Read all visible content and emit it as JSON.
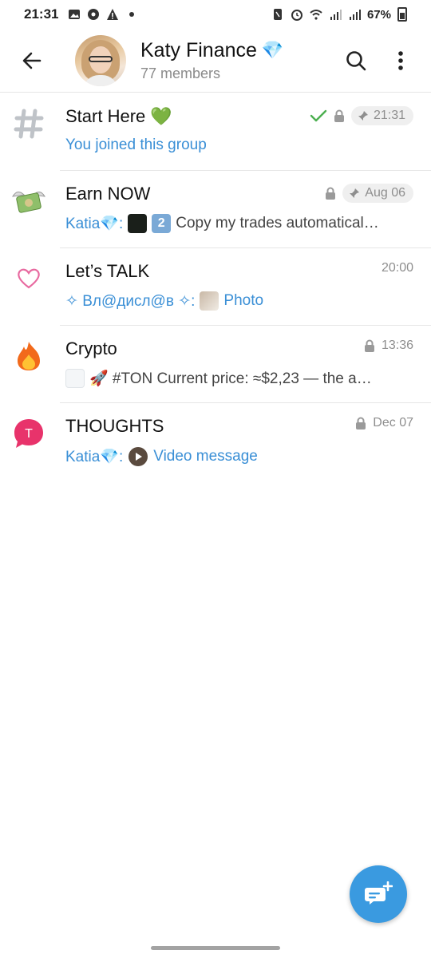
{
  "status_bar": {
    "time": "21:31",
    "battery": "67%",
    "left_icons": [
      "image-icon",
      "soccer-ball-icon",
      "warning-icon",
      "dot-icon"
    ],
    "right_icons": [
      "nfc-icon",
      "alarm-icon",
      "wifi-icon",
      "signal-icon",
      "signal-icon",
      "battery-icon"
    ]
  },
  "header": {
    "title": "Katy Finance",
    "title_emoji": "💎",
    "subtitle": "77 members"
  },
  "topics": [
    {
      "name": "Start Here",
      "name_emoji": "💚",
      "icon": "hash-icon",
      "time": "21:31",
      "read": true,
      "locked": true,
      "pinned": true,
      "message": "You joined this group"
    },
    {
      "name": "Earn NOW",
      "icon": "money-wings-icon",
      "time": "Aug 06",
      "locked": true,
      "pinned": true,
      "sender": "Katia💎:",
      "keycap": "2",
      "message": "Copy my trades automatical…"
    },
    {
      "name": "Let’s TALK",
      "icon": "heart-icon",
      "time": "20:00",
      "sender": "✧ Вл@дисл@в ✧:",
      "message": "Photo"
    },
    {
      "name": "Crypto",
      "icon": "fire-icon",
      "time": "13:36",
      "locked": true,
      "message": "🚀 #TON  Current price: ≈$2,23 — the a…"
    },
    {
      "name": "THOUGHTS",
      "icon": "speech-bubble-icon",
      "icon_letter": "T",
      "time": "Dec 07",
      "locked": true,
      "sender": "Katia💎:",
      "message": "Video message"
    }
  ],
  "colors": {
    "accent": "#3a8fd6",
    "fab": "#3a9ae0",
    "read_check": "#4caf50",
    "heart": "#e86aa0",
    "thoughts_bubble": "#e8336b"
  }
}
